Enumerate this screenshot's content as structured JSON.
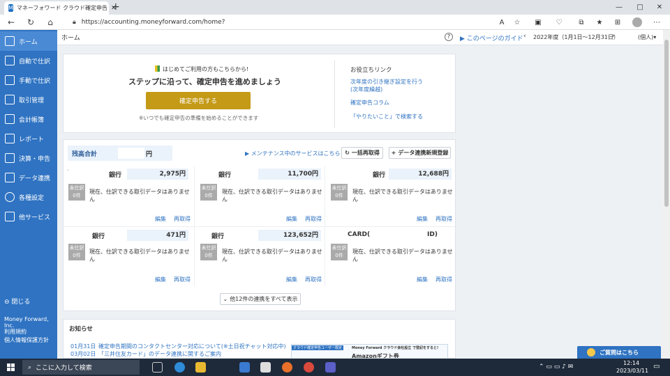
{
  "browser": {
    "tab_title": "マネーフォワード クラウド確定申告",
    "new_tab": "+",
    "url": "https://accounting.moneyforward.com/home?",
    "minimize": "—",
    "maximize": "□",
    "close": "✕"
  },
  "sidebar": {
    "items": [
      {
        "label": "ホーム"
      },
      {
        "label": "自動で仕訳"
      },
      {
        "label": "手動で仕訳"
      },
      {
        "label": "取引管理"
      },
      {
        "label": "会計帳簿"
      },
      {
        "label": "レポート"
      },
      {
        "label": "決算・申告"
      },
      {
        "label": "データ連携"
      },
      {
        "label": "各種設定"
      },
      {
        "label": "他サービス"
      }
    ],
    "close_label": "閉じる",
    "company": "Money Forward, Inc.",
    "terms": "利用規約",
    "privacy": "個人情報保護方針"
  },
  "header": {
    "breadcrumb": "ホーム",
    "guide": "このページのガイド",
    "fiscal_year": "2022年度（1月1日〜12月31日）",
    "user_type": "(個人)▾"
  },
  "intro": {
    "first_time": "はじめてご利用の方もこちらから!",
    "headline": "ステップに沿って、確定申告を進めましょう",
    "cta": "確定申告する",
    "note": "※いつでも確定申告の準備を始めることができます",
    "links_title": "お役立ちリンク",
    "link1": "次年度の引き継ぎ設定を行う",
    "link1b": "(次年度繰越)",
    "link2": "確定申告コラム",
    "link3": "「やりたいこと」で検索する"
  },
  "balance": {
    "title": "残高合計",
    "unit": "円",
    "maintenance": "メンテナンス中のサービスはこちら",
    "refresh_all": "一括再取得",
    "add_link": "データ連携新規登録",
    "badge_top": "未仕訳",
    "badge_bottom": "0件",
    "nodata": "現在、仕訳できる取引データはありません",
    "edit": "編集",
    "refetch": "再取得",
    "show_all": "他12件の連携をすべて表示",
    "accounts": [
      {
        "name": "銀行",
        "amount": "2,975円"
      },
      {
        "name": "銀行",
        "amount": "11,700円"
      },
      {
        "name": "銀行",
        "amount": "12,688円"
      },
      {
        "name": "銀行",
        "amount": "471円"
      },
      {
        "name": "銀行",
        "amount": "123,652円"
      },
      {
        "name": "CARD(",
        "amount": "ID)"
      }
    ],
    "dot": "'"
  },
  "news": {
    "title": "お知らせ",
    "item1_date": "01月31日",
    "item1_text": "確定申告期間のコンタクトセンター対応について(※土日祝チャット対応中)",
    "item2_date": "03月02日",
    "item2_text": "「三井住友カード」のデータ連携に関するご案内",
    "banner_line": "クラウド確定申告ユーザー限定",
    "banner_brand": "Money Forward クラウド会社設立 で登記をすると!",
    "banner_gift": "Amazonギフト券",
    "help": "ご質問はこちら"
  },
  "taskbar": {
    "search": "ここに入力して検索",
    "time": "12:14",
    "date": "2023/03/11"
  },
  "colors": {
    "sidebar": "#2f73c2",
    "cta": "#c49a16",
    "link": "#2f73c2"
  }
}
